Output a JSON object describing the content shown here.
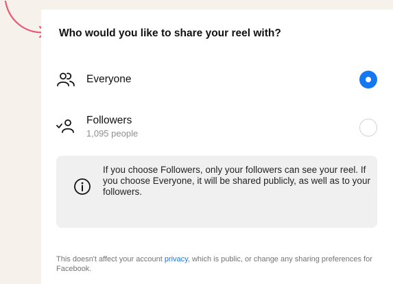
{
  "title": "Who would you like to share your reel with?",
  "options": [
    {
      "label": "Everyone",
      "selected": true,
      "icon": "people-icon"
    },
    {
      "label": "Followers",
      "sublabel": "1,095 people",
      "selected": false,
      "icon": "followers-icon"
    }
  ],
  "info": {
    "icon": "info-icon",
    "text": "If you choose Followers, only your followers can see your reel. If you choose Everyone, it will be shared publicly, as well as to your followers."
  },
  "footer": {
    "before": "This doesn't affect your account ",
    "link": "privacy",
    "after": ", which is public, or change any sharing preferences for Facebook."
  },
  "colors": {
    "accent": "#1479f0",
    "background": "#f6f1ea",
    "annotation_arrow": "#e8597a"
  }
}
